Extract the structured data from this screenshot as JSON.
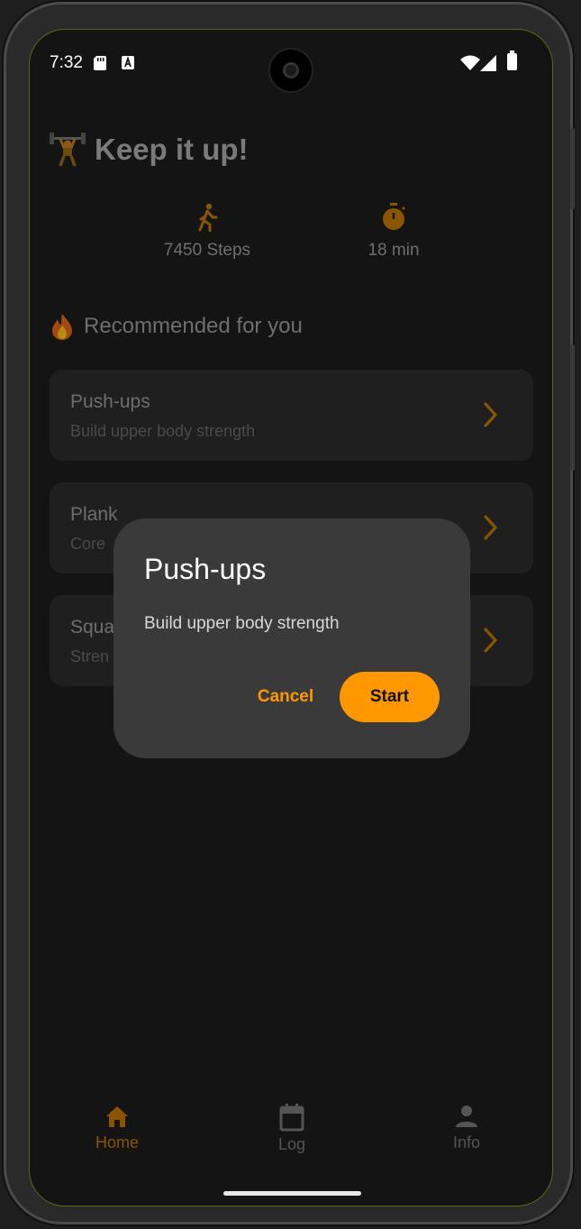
{
  "status_bar": {
    "time": "7:32"
  },
  "header": {
    "title": "Keep it up!",
    "emoji": "weight-lifter-icon"
  },
  "stats": [
    {
      "value": "7450 Steps",
      "icon": "walking-icon"
    },
    {
      "value": "18 min",
      "icon": "timer-icon"
    }
  ],
  "recommended": {
    "heading": "Recommended for you",
    "items": [
      {
        "title": "Push-ups",
        "subtitle": "Build upper body strength"
      },
      {
        "title": "Plank",
        "subtitle": "Core"
      },
      {
        "title": "Squa",
        "subtitle": "Stren"
      }
    ]
  },
  "dialog": {
    "title": "Push-ups",
    "body": "Build upper body strength",
    "cancel_label": "Cancel",
    "start_label": "Start"
  },
  "bottom_nav": {
    "items": [
      {
        "label": "Home",
        "icon": "home-icon",
        "active": true
      },
      {
        "label": "Log",
        "icon": "calendar-icon",
        "active": false
      },
      {
        "label": "Info",
        "icon": "person-icon",
        "active": false
      }
    ]
  },
  "colors": {
    "accent": "#ff9800",
    "background": "#141414",
    "dialog": "#3a3a3a"
  }
}
